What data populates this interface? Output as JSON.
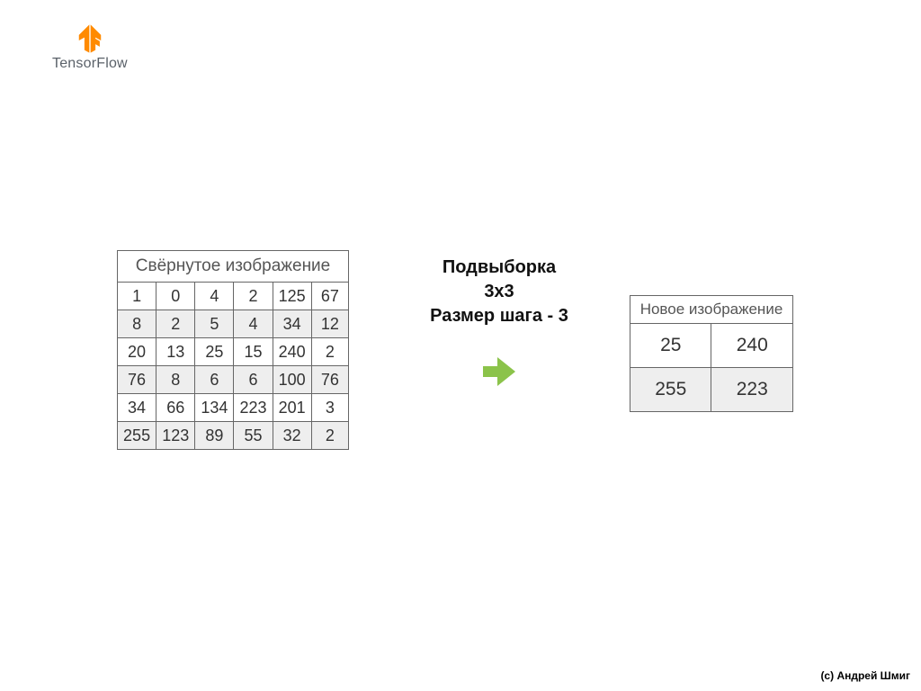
{
  "logo": {
    "text": "TensorFlow"
  },
  "left": {
    "title": "Свёрнутое изображение",
    "rows": [
      [
        "1",
        "0",
        "4",
        "2",
        "125",
        "67"
      ],
      [
        "8",
        "2",
        "5",
        "4",
        "34",
        "12"
      ],
      [
        "20",
        "13",
        "25",
        "15",
        "240",
        "2"
      ],
      [
        "76",
        "8",
        "6",
        "6",
        "100",
        "76"
      ],
      [
        "34",
        "66",
        "134",
        "223",
        "201",
        "3"
      ],
      [
        "255",
        "123",
        "89",
        "55",
        "32",
        "2"
      ]
    ]
  },
  "center": {
    "line1": "Подвыборка",
    "line2": "3x3",
    "line3": "Размер шага - 3"
  },
  "right": {
    "title": "Новое изображение",
    "rows": [
      [
        "25",
        "240"
      ],
      [
        "255",
        "223"
      ]
    ]
  },
  "credit": "(с) Андрей Шмиг",
  "colors": {
    "brand": "#ff8a00",
    "arrow": "#8bc34a"
  }
}
